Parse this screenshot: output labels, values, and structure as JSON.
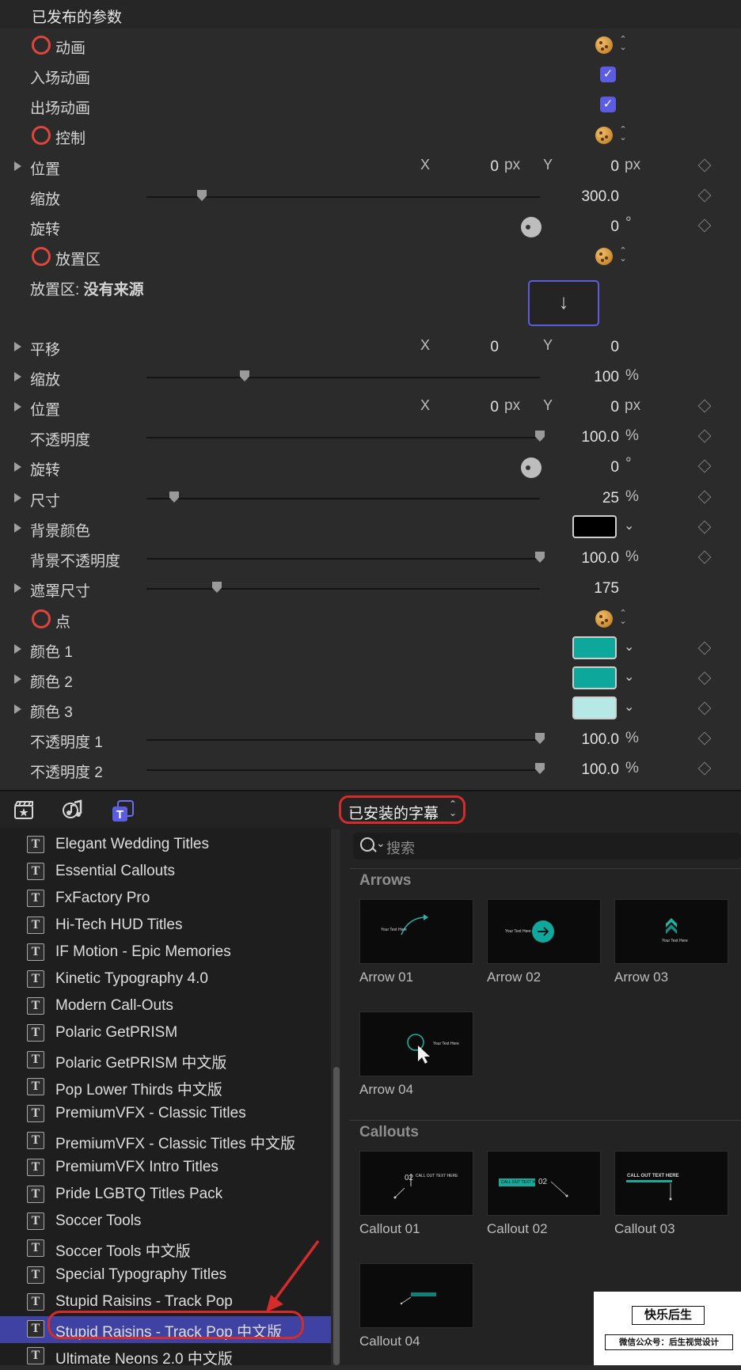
{
  "inspector": {
    "header": "已发布的参数",
    "rows": [
      {
        "label": "动画",
        "type": "group"
      },
      {
        "label": "入场动画",
        "type": "checkbox",
        "checked": true
      },
      {
        "label": "出场动画",
        "type": "checkbox",
        "checked": true
      },
      {
        "label": "控制",
        "type": "group"
      },
      {
        "label": "位置",
        "type": "xy",
        "x": "0",
        "y": "0",
        "unit": "px",
        "x_label": "X",
        "y_label": "Y"
      },
      {
        "label": "缩放",
        "type": "slider",
        "value": "300.0",
        "level": 0.14
      },
      {
        "label": "旋转",
        "type": "dial",
        "value": "0",
        "unit": "°"
      },
      {
        "label": "放置区",
        "type": "group"
      },
      {
        "label": "放置区:",
        "bold": "没有来源",
        "type": "dropzone",
        "icon": "down-arrow-icon"
      },
      {
        "label": "平移",
        "type": "xy",
        "x": "0",
        "y": "0",
        "unit": "",
        "x_label": "X",
        "y_label": "Y"
      },
      {
        "label": "缩放",
        "type": "slider",
        "value": "100",
        "unit": "%",
        "level": 0.25
      },
      {
        "label": "位置",
        "type": "xy",
        "x": "0",
        "y": "0",
        "unit": "px",
        "x_label": "X",
        "y_label": "Y"
      },
      {
        "label": "不透明度",
        "type": "slider",
        "value": "100.0",
        "unit": "%",
        "level": 1.0
      },
      {
        "label": "旋转",
        "type": "dial",
        "value": "0",
        "unit": "°"
      },
      {
        "label": "尺寸",
        "type": "slider",
        "value": "25",
        "unit": "%",
        "level": 0.07
      },
      {
        "label": "背景颜色",
        "type": "color",
        "color": "#000000"
      },
      {
        "label": "背景不透明度",
        "type": "slider",
        "value": "100.0",
        "unit": "%",
        "level": 1.0
      },
      {
        "label": "遮罩尺寸",
        "type": "slider",
        "value": "175",
        "level": 0.18
      },
      {
        "label": "点",
        "type": "group"
      },
      {
        "label": "颜色 1",
        "type": "color",
        "color": "#0ea79b"
      },
      {
        "label": "颜色 2",
        "type": "color",
        "color": "#0ea79b"
      },
      {
        "label": "颜色 3",
        "type": "color",
        "color": "#b6e8e6"
      },
      {
        "label": "不透明度 1",
        "type": "slider",
        "value": "100.0",
        "unit": "%",
        "level": 1.0
      },
      {
        "label": "不透明度 2",
        "type": "slider",
        "value": "100.0",
        "unit": "%",
        "level": 1.0
      }
    ]
  },
  "toolbar": {
    "icons": [
      "clapper-star-icon",
      "music-note-icon",
      "titles-icon"
    ],
    "popup_label": "已安装的字幕",
    "popup_icon": "updown-chevron-icon"
  },
  "title_list": {
    "items": [
      "Elegant Wedding Titles",
      "Essential Callouts",
      "FxFactory Pro",
      "Hi-Tech HUD Titles",
      "IF Motion - Epic Memories",
      "Kinetic Typography 4.0",
      "Modern Call-Outs",
      "Polaric GetPRISM",
      "Polaric GetPRISM 中文版",
      "Pop Lower Thirds 中文版",
      "PremiumVFX - Classic Titles",
      "PremiumVFX - Classic Titles 中文版",
      "PremiumVFX Intro Titles",
      "Pride LGBTQ Titles Pack",
      "Soccer Tools",
      "Soccer Tools 中文版",
      "Special Typography Titles",
      "Stupid Raisins - Track Pop",
      "Stupid Raisins - Track Pop 中文版",
      "Ultimate Neons 2.0 中文版"
    ],
    "selected_index": 18,
    "item_icon": "T"
  },
  "browser": {
    "search_placeholder": "搜索",
    "sections": [
      {
        "title": "Arrows",
        "items": [
          {
            "label": "Arrow 01",
            "preview_text": "Your Text Here"
          },
          {
            "label": "Arrow 02",
            "preview_text": "Your Text Here"
          },
          {
            "label": "Arrow 03",
            "preview_text": "Your Text Here"
          },
          {
            "label": "Arrow 04",
            "preview_text": "Your Text Here"
          }
        ]
      },
      {
        "title": "Callouts",
        "items": [
          {
            "label": "Callout 01",
            "preview_text": "CALL OUT TEXT HERE",
            "preview_num": "02"
          },
          {
            "label": "Callout 02",
            "preview_text": "CALL OUT TEXT HERE",
            "preview_num": "02"
          },
          {
            "label": "Callout 03",
            "preview_text": "CALL OUT TEXT HERE"
          },
          {
            "label": "Callout 04",
            "preview_text": ""
          }
        ]
      }
    ]
  },
  "watermark": {
    "line1": "快乐后生",
    "line2": "微信公众号：后生视觉设计"
  },
  "colors": {
    "accent": "#5b5ce0",
    "selection": "#3f42a2",
    "highlight_ring": "#d42b2b",
    "teal": "#0ea79b"
  }
}
